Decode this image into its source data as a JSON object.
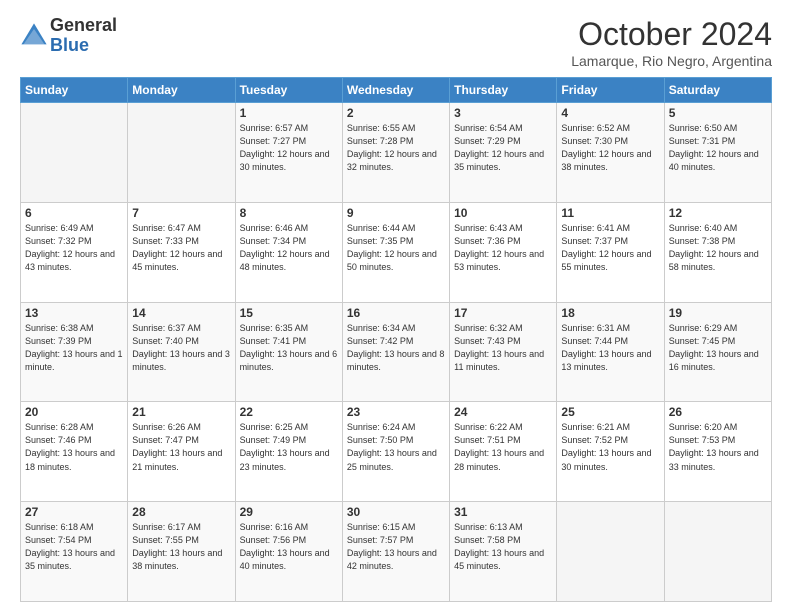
{
  "logo": {
    "general": "General",
    "blue": "Blue"
  },
  "header": {
    "month": "October 2024",
    "location": "Lamarque, Rio Negro, Argentina"
  },
  "days_of_week": [
    "Sunday",
    "Monday",
    "Tuesday",
    "Wednesday",
    "Thursday",
    "Friday",
    "Saturday"
  ],
  "weeks": [
    [
      {
        "day": "",
        "sunrise": "",
        "sunset": "",
        "daylight": ""
      },
      {
        "day": "",
        "sunrise": "",
        "sunset": "",
        "daylight": ""
      },
      {
        "day": "1",
        "sunrise": "Sunrise: 6:57 AM",
        "sunset": "Sunset: 7:27 PM",
        "daylight": "Daylight: 12 hours and 30 minutes."
      },
      {
        "day": "2",
        "sunrise": "Sunrise: 6:55 AM",
        "sunset": "Sunset: 7:28 PM",
        "daylight": "Daylight: 12 hours and 32 minutes."
      },
      {
        "day": "3",
        "sunrise": "Sunrise: 6:54 AM",
        "sunset": "Sunset: 7:29 PM",
        "daylight": "Daylight: 12 hours and 35 minutes."
      },
      {
        "day": "4",
        "sunrise": "Sunrise: 6:52 AM",
        "sunset": "Sunset: 7:30 PM",
        "daylight": "Daylight: 12 hours and 38 minutes."
      },
      {
        "day": "5",
        "sunrise": "Sunrise: 6:50 AM",
        "sunset": "Sunset: 7:31 PM",
        "daylight": "Daylight: 12 hours and 40 minutes."
      }
    ],
    [
      {
        "day": "6",
        "sunrise": "Sunrise: 6:49 AM",
        "sunset": "Sunset: 7:32 PM",
        "daylight": "Daylight: 12 hours and 43 minutes."
      },
      {
        "day": "7",
        "sunrise": "Sunrise: 6:47 AM",
        "sunset": "Sunset: 7:33 PM",
        "daylight": "Daylight: 12 hours and 45 minutes."
      },
      {
        "day": "8",
        "sunrise": "Sunrise: 6:46 AM",
        "sunset": "Sunset: 7:34 PM",
        "daylight": "Daylight: 12 hours and 48 minutes."
      },
      {
        "day": "9",
        "sunrise": "Sunrise: 6:44 AM",
        "sunset": "Sunset: 7:35 PM",
        "daylight": "Daylight: 12 hours and 50 minutes."
      },
      {
        "day": "10",
        "sunrise": "Sunrise: 6:43 AM",
        "sunset": "Sunset: 7:36 PM",
        "daylight": "Daylight: 12 hours and 53 minutes."
      },
      {
        "day": "11",
        "sunrise": "Sunrise: 6:41 AM",
        "sunset": "Sunset: 7:37 PM",
        "daylight": "Daylight: 12 hours and 55 minutes."
      },
      {
        "day": "12",
        "sunrise": "Sunrise: 6:40 AM",
        "sunset": "Sunset: 7:38 PM",
        "daylight": "Daylight: 12 hours and 58 minutes."
      }
    ],
    [
      {
        "day": "13",
        "sunrise": "Sunrise: 6:38 AM",
        "sunset": "Sunset: 7:39 PM",
        "daylight": "Daylight: 13 hours and 1 minute."
      },
      {
        "day": "14",
        "sunrise": "Sunrise: 6:37 AM",
        "sunset": "Sunset: 7:40 PM",
        "daylight": "Daylight: 13 hours and 3 minutes."
      },
      {
        "day": "15",
        "sunrise": "Sunrise: 6:35 AM",
        "sunset": "Sunset: 7:41 PM",
        "daylight": "Daylight: 13 hours and 6 minutes."
      },
      {
        "day": "16",
        "sunrise": "Sunrise: 6:34 AM",
        "sunset": "Sunset: 7:42 PM",
        "daylight": "Daylight: 13 hours and 8 minutes."
      },
      {
        "day": "17",
        "sunrise": "Sunrise: 6:32 AM",
        "sunset": "Sunset: 7:43 PM",
        "daylight": "Daylight: 13 hours and 11 minutes."
      },
      {
        "day": "18",
        "sunrise": "Sunrise: 6:31 AM",
        "sunset": "Sunset: 7:44 PM",
        "daylight": "Daylight: 13 hours and 13 minutes."
      },
      {
        "day": "19",
        "sunrise": "Sunrise: 6:29 AM",
        "sunset": "Sunset: 7:45 PM",
        "daylight": "Daylight: 13 hours and 16 minutes."
      }
    ],
    [
      {
        "day": "20",
        "sunrise": "Sunrise: 6:28 AM",
        "sunset": "Sunset: 7:46 PM",
        "daylight": "Daylight: 13 hours and 18 minutes."
      },
      {
        "day": "21",
        "sunrise": "Sunrise: 6:26 AM",
        "sunset": "Sunset: 7:47 PM",
        "daylight": "Daylight: 13 hours and 21 minutes."
      },
      {
        "day": "22",
        "sunrise": "Sunrise: 6:25 AM",
        "sunset": "Sunset: 7:49 PM",
        "daylight": "Daylight: 13 hours and 23 minutes."
      },
      {
        "day": "23",
        "sunrise": "Sunrise: 6:24 AM",
        "sunset": "Sunset: 7:50 PM",
        "daylight": "Daylight: 13 hours and 25 minutes."
      },
      {
        "day": "24",
        "sunrise": "Sunrise: 6:22 AM",
        "sunset": "Sunset: 7:51 PM",
        "daylight": "Daylight: 13 hours and 28 minutes."
      },
      {
        "day": "25",
        "sunrise": "Sunrise: 6:21 AM",
        "sunset": "Sunset: 7:52 PM",
        "daylight": "Daylight: 13 hours and 30 minutes."
      },
      {
        "day": "26",
        "sunrise": "Sunrise: 6:20 AM",
        "sunset": "Sunset: 7:53 PM",
        "daylight": "Daylight: 13 hours and 33 minutes."
      }
    ],
    [
      {
        "day": "27",
        "sunrise": "Sunrise: 6:18 AM",
        "sunset": "Sunset: 7:54 PM",
        "daylight": "Daylight: 13 hours and 35 minutes."
      },
      {
        "day": "28",
        "sunrise": "Sunrise: 6:17 AM",
        "sunset": "Sunset: 7:55 PM",
        "daylight": "Daylight: 13 hours and 38 minutes."
      },
      {
        "day": "29",
        "sunrise": "Sunrise: 6:16 AM",
        "sunset": "Sunset: 7:56 PM",
        "daylight": "Daylight: 13 hours and 40 minutes."
      },
      {
        "day": "30",
        "sunrise": "Sunrise: 6:15 AM",
        "sunset": "Sunset: 7:57 PM",
        "daylight": "Daylight: 13 hours and 42 minutes."
      },
      {
        "day": "31",
        "sunrise": "Sunrise: 6:13 AM",
        "sunset": "Sunset: 7:58 PM",
        "daylight": "Daylight: 13 hours and 45 minutes."
      },
      {
        "day": "",
        "sunrise": "",
        "sunset": "",
        "daylight": ""
      },
      {
        "day": "",
        "sunrise": "",
        "sunset": "",
        "daylight": ""
      }
    ]
  ]
}
